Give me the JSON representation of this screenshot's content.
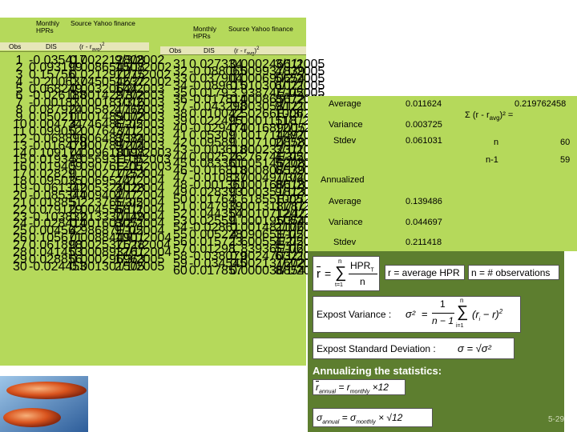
{
  "left_table": {
    "title_lines": [
      "Monthly",
      "HPRs"
    ],
    "source": "Source Yahoo finance",
    "col_obs": "Obs",
    "col_dis": "DIS",
    "col_dev": "(r - r",
    "col_dev_sub": "avg",
    "col_dev_tail": ")",
    "col_dev_sup": "2",
    "rows": [
      [
        "1",
        "-0.035417",
        "0.002212808",
        "9/3/2002"
      ],
      [
        "2",
        "0.093199",
        "0.008654508",
        "10/1/2002"
      ],
      [
        "3",
        "0.15756",
        "0.021297275",
        "11/1/2002"
      ],
      [
        "4",
        "-0.200637",
        "0.045054632",
        "12/2/2002"
      ],
      [
        "5",
        "0.068249",
        "0.00320644",
        "1/2/2003"
      ],
      [
        "6",
        "-0.026188",
        "0.001429702",
        "2/3/2003"
      ],
      [
        "7",
        "-0.00183",
        "0.000181016",
        "3/3/2003"
      ],
      [
        "8",
        "0.087924",
        "0.005821766",
        "4/1/2003"
      ],
      [
        "9",
        "0.050211",
        "0.001489002",
        "5/1/2003"
      ],
      [
        "10",
        "0.004734",
        "4.74648E-05",
        "6/2/2003"
      ],
      [
        "11",
        "0.099052",
        "0.00764371",
        "7/1/2003"
      ],
      [
        "12",
        "-0.068896",
        "0.006483384",
        "8/1/2003"
      ],
      [
        "13",
        "-0.016479",
        "0.000789704",
        "9/2/2003"
      ],
      [
        "14",
        "0.109174",
        "0.009618098",
        "10/1/2003"
      ],
      [
        "15",
        "0.019348",
        "5.05693E-05",
        "11/3/2003"
      ],
      [
        "16",
        "0.019409",
        "5.09076E-05",
        "12/1/2003"
      ],
      [
        "17",
        "0.02829",
        "0.000277753",
        "1/2/2004"
      ],
      [
        "18",
        "0.095035",
        "0.00695741",
        "2/2/2004"
      ],
      [
        "19",
        "-0.061342",
        "0.005324028",
        "3/1/2004"
      ],
      [
        "20",
        "-0.085344",
        "0.00940277",
        "4/1/2004"
      ],
      [
        "21",
        "0.018851",
        "5.22376E-05",
        "5/3/2004"
      ],
      [
        "22",
        "0.079129",
        "0.004556811",
        "6/1/2004"
      ],
      [
        "23",
        "-0.103832",
        "0.013330149",
        "7/1/2004"
      ],
      [
        "24",
        "-0.028414",
        "0.001603051",
        "8/2/2004"
      ],
      [
        "25",
        "0.004562",
        "4.98687E-05",
        "9/1/2004"
      ],
      [
        "26",
        "0.105671",
        "0.008844901",
        "10/1/2004"
      ],
      [
        "27",
        "0.061898",
        "0.002537528",
        "11/1/2004"
      ],
      [
        "28",
        "0.041453",
        "0.000893761",
        "12/1/2004"
      ],
      [
        "29",
        "0.028856",
        "0.000296963",
        "1/3/2005"
      ],
      [
        "30",
        "-0.024453",
        "0.001301505",
        "2/1/2005"
      ]
    ]
  },
  "right_table": {
    "title_lines": [
      "Monthly",
      "HPRs"
    ],
    "source": "Source Yahoo finance",
    "col_obs": "Obs",
    "col_dis": "DIS",
    "col_dev": "(r - r",
    "col_dev_sub": "avg",
    "col_dev_tail": ")",
    "col_dev_sup": "2",
    "rows": [
      [
        "31",
        "0.027334",
        "0.000246611",
        "3/1/2005"
      ],
      [
        "32",
        "-0.088065",
        "0.009937839",
        "4/1/2005"
      ],
      [
        "33",
        "0.037904",
        "0.000690654",
        "5/2/2005"
      ],
      [
        "34",
        "-0.089615",
        "0.010301021",
        "6/1/2005"
      ],
      [
        "35",
        "0.0179",
        "3.93874E-05",
        "7/1/2005"
      ],
      [
        "36",
        "-0.017814",
        "0.000865672",
        "8/1/2005"
      ],
      [
        "37",
        "-0.043298",
        "0.003058121",
        "9/1/2005"
      ],
      [
        "38",
        "0.010042",
        "2.50266E-06",
        "10/3/2005"
      ],
      [
        "39",
        "0.022495",
        "0.00011518",
        "11/1/2005"
      ],
      [
        "40",
        "-0.029474",
        "0.001689005",
        "12/1/2005"
      ],
      [
        "41",
        "0.05309",
        "0.001714497",
        "1/3/2006"
      ],
      [
        "42",
        "0.09589",
        "0.007100858",
        "2/1/2006"
      ],
      [
        "43",
        "-0.003618",
        "0.000232311",
        "3/1/2006"
      ],
      [
        "44",
        "0.002526",
        "0.27674E-05",
        "4/3/2006"
      ],
      [
        "45",
        "0.083361",
        "0.005146208",
        "5/1/2006"
      ],
      [
        "46",
        "-0.016818",
        "0.000808539",
        "6/1/2006"
      ],
      [
        "47",
        "-0.010837",
        "0.000491104",
        "7/3/2006"
      ],
      [
        "48",
        "-0.001361",
        "0.000168618",
        "8/1/2006"
      ],
      [
        "49",
        "0.028393",
        "0.000351813",
        "9/1/2006"
      ],
      [
        "50",
        "0.01764",
        "3.61855E-05",
        "10/2/2006"
      ],
      [
        "51",
        "0.047939",
        "0.001318787",
        "11/1/2006"
      ],
      [
        "52",
        "0.044354",
        "0.001071242",
        "12/1/2006"
      ],
      [
        "53",
        "0.02559",
        "0.000195054",
        "1/3/2007"
      ],
      [
        "54",
        "-0.02861",
        "0.001481106",
        "2/1/2007"
      ],
      [
        "55",
        "0.005228",
        "4.09065E-05",
        "3/1/2007"
      ],
      [
        "56",
        "0.015723",
        "1.60055E-05",
        "4/2/2007"
      ],
      [
        "57",
        "0.01298",
        "1.83936E-06",
        "5/1/2007"
      ],
      [
        "58",
        "-0.038079",
        "0.002470321",
        "6/1/2007"
      ],
      [
        "59",
        "-0.034545",
        "0.002131602",
        "7/2/2007"
      ],
      [
        "60",
        "0.017857",
        "0.000038854",
        "8/1/2007"
      ]
    ]
  },
  "stats": {
    "average_label": "Average",
    "average_value": "0.011624",
    "sum_value": "0.219762458",
    "variance_label": "Variance",
    "variance_value": "0.003725",
    "sum_label_pre": "Σ (r - r",
    "sum_label_sub": "avg",
    "sum_label_post": ")² =",
    "stdev_label": "Stdev",
    "stdev_value": "0.061031",
    "n_label": "n",
    "n_value": "60",
    "n1_label": "n-1",
    "n1_value": "59",
    "annualized_label": "Annualized",
    "ann_average_label": "Average",
    "ann_average_value": "0.139486",
    "ann_variance_label": "Variance",
    "ann_variance_value": "0.044697",
    "ann_stdev_label": "Stdev",
    "ann_stdev_value": "0.211418"
  },
  "formulas": {
    "mean_r": "r",
    "mean_eq": "=",
    "mean_num": "HPR",
    "mean_num_sub": "T",
    "mean_den": "n",
    "sum_top": "n",
    "sum_bottom": "t=1",
    "avg_text": "r = average HPR",
    "n_text": "n = # observations",
    "expost_var_label": "Expost Variance :",
    "sigma2": "σ²",
    "var_eq": "=",
    "one": "1",
    "n_minus_1": "n − 1",
    "var_body": "(r",
    "var_body_sub": "i",
    "var_body_tail": "− r)",
    "var_sup": "2",
    "var_sum_top": "n",
    "var_sum_bottom": "i=1",
    "expost_sd_label": "Expost  Standard  Deviation :",
    "sd_formula": "σ = √σ²",
    "annualizing_title": "Annualizing the statistics:",
    "ann_mean_lhs": "r",
    "ann_mean_lhs_sub": "annual",
    "ann_mean_eq": "= r",
    "ann_mean_rhs_sub": "monthly",
    "ann_mean_mult": "×12",
    "ann_sd_lhs": "σ",
    "ann_sd_lhs_sub": "annual",
    "ann_sd_eq": "= σ",
    "ann_sd_rhs_sub": "monthly",
    "ann_sd_mult": "× √12"
  },
  "page_number": "5-29",
  "colors": {
    "sheet_green": "#b5d95b",
    "header_band": "#e6e6b9",
    "formula_green": "#5d7e2f"
  }
}
